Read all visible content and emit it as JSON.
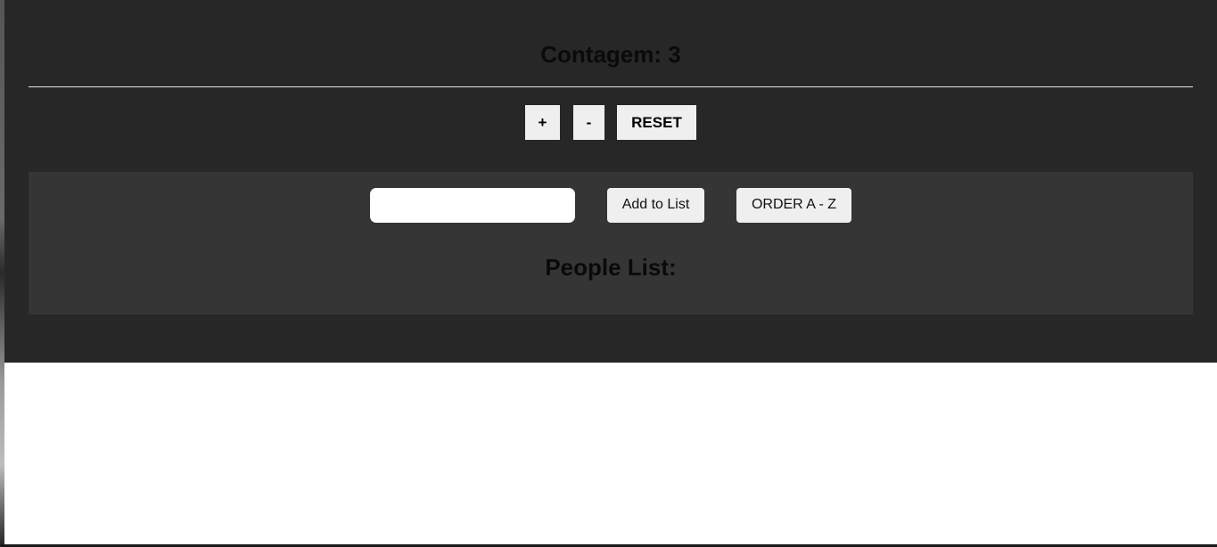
{
  "counter": {
    "label": "Contagem: 3",
    "value": 3,
    "increment_label": "+",
    "decrement_label": "-",
    "reset_label": "RESET"
  },
  "people": {
    "input_value": "",
    "input_placeholder": "",
    "add_label": "Add to List",
    "order_label": "ORDER A - Z",
    "list_title": "People List:",
    "items": []
  },
  "colors": {
    "app_background": "#282728",
    "panel_background": "#363536",
    "button_background": "#efefef",
    "page_background": "#ffffff"
  }
}
